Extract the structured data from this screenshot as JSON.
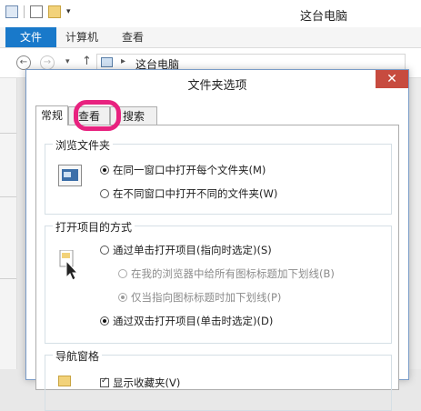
{
  "window": {
    "title": "这台电脑",
    "ribbon_tabs": {
      "file": "文件",
      "computer": "计算机",
      "view": "查看"
    },
    "address": {
      "location": "这台电脑",
      "back_glyph": "←",
      "forward_glyph": "→",
      "up_glyph": "↑",
      "separator": "▸",
      "dropdown_glyph": "▾"
    },
    "qat_dropdown": "▾"
  },
  "dialog": {
    "title": "文件夹选项",
    "close_glyph": "✕",
    "tabs": {
      "general": "常规",
      "view": "查看",
      "search": "搜索"
    },
    "browse": {
      "title": "浏览文件夹",
      "same_window": "在同一窗口中打开每个文件夹(M)",
      "new_window": "在不同窗口中打开不同的文件夹(W)",
      "selected": "same_window"
    },
    "click": {
      "title": "打开项目的方式",
      "single_click": "通过单击打开项目(指向时选定)(S)",
      "underline_all": "在我的浏览器中给所有图标标题加下划线(B)",
      "underline_hover": "仅当指向图标标题时加下划线(P)",
      "double_click": "通过双击打开项目(单击时选定)(D)",
      "selected": "double_click"
    },
    "nav_pane": {
      "title": "导航窗格",
      "show_favorites": "显示收藏夹(V)"
    }
  },
  "colors": {
    "file_tab": "#1979ca",
    "close_button": "#c74b3f",
    "highlight": "#e8227f"
  }
}
